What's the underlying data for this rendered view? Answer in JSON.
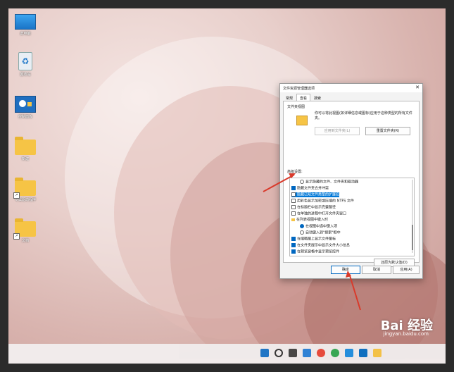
{
  "desktop": {
    "icons": [
      {
        "label": "此电脑",
        "type": "monitor"
      },
      {
        "label": "回收站",
        "type": "recycle-bin"
      },
      {
        "label": "控制面板",
        "type": "control-panel"
      },
      {
        "label": "新建",
        "type": "folder"
      },
      {
        "label": "专属驱动程序",
        "type": "folder-shortcut"
      },
      {
        "label": "文档",
        "type": "folder-shortcut"
      }
    ]
  },
  "dialog": {
    "title": "文件资源管理器选项",
    "tabs": [
      "常规",
      "查看",
      "搜索"
    ],
    "active_tab": "查看",
    "folder_views": {
      "label": "文件夹视图",
      "description": "你可以将此视图(如详细信息或图标)应用于这种类型的所有文件夹。",
      "apply_button": "应用到文件夹(L)",
      "reset_button": "重置文件夹(R)"
    },
    "advanced": {
      "label": "高级设置:",
      "items": [
        {
          "text": "显示隐藏的文件、文件夹和驱动器",
          "control": "radio",
          "checked": false
        },
        {
          "text": "隐藏文件夹合并冲突",
          "control": "checkbox",
          "checked": true
        },
        {
          "text": "隐藏已知文件类型的扩展名",
          "control": "checkbox",
          "checked": false,
          "selected": true
        },
        {
          "text": "用彩色显示加密或压缩的 NTFS 文件",
          "control": "checkbox",
          "checked": false
        },
        {
          "text": "在标题栏中显示完整路径",
          "control": "checkbox",
          "checked": false
        },
        {
          "text": "在单独的进程中打开文件夹窗口",
          "control": "checkbox",
          "checked": false
        },
        {
          "text": "在列表视图中键入时",
          "control": "folder",
          "checked": false
        },
        {
          "text": "在视图中选中键入项",
          "control": "radio",
          "checked": true
        },
        {
          "text": "自动键入到\"搜索\"框中",
          "control": "radio",
          "checked": false
        },
        {
          "text": "在缩略图上显示文件图标",
          "control": "checkbox",
          "checked": true
        },
        {
          "text": "在文件夹提示中显示文件大小信息",
          "control": "checkbox",
          "checked": true
        },
        {
          "text": "在预览窗格中显示预览控件",
          "control": "checkbox",
          "checked": true
        }
      ],
      "restore_button": "还原为默认值(D)"
    },
    "ok_button": "确定",
    "cancel_button": "取消",
    "apply_button": "应用(A)"
  },
  "watermark": {
    "text": "Bai 经验",
    "url": "jingyan.baidu.com"
  },
  "colors": {
    "accent": "#0067c0",
    "arrow": "#d93a2b",
    "folder": "#f6c445"
  }
}
